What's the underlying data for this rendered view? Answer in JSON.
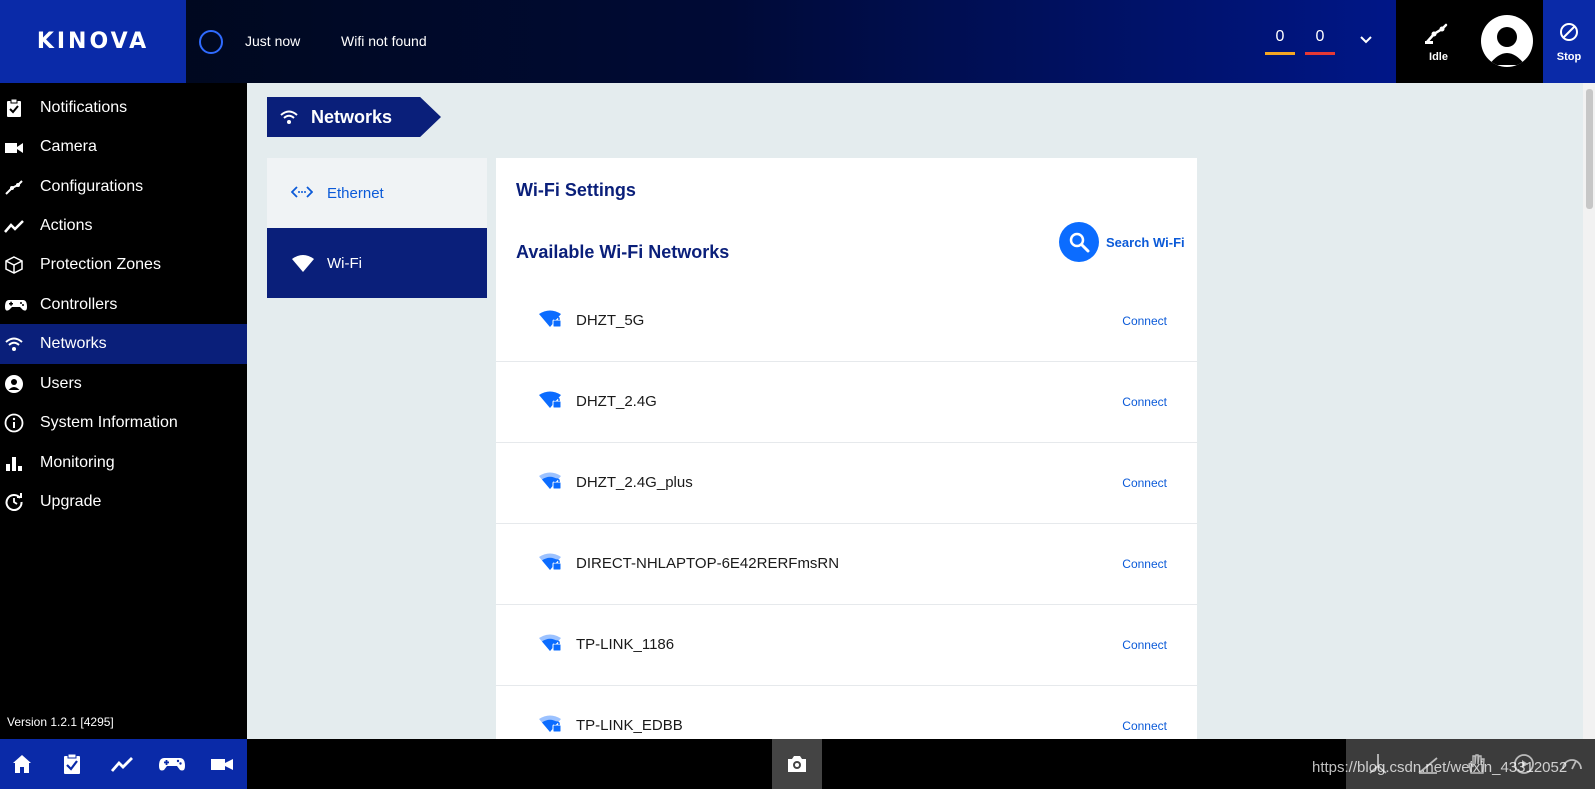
{
  "header": {
    "logo": "KINOVA",
    "status_time": "Just now",
    "wifi_status": "Wifi not found",
    "counter_warnings": "0",
    "counter_errors": "0",
    "robot_state": "Idle",
    "stop_label": "Stop"
  },
  "sidebar": {
    "items": [
      {
        "label": "Notifications",
        "icon": "notifications-icon"
      },
      {
        "label": "Camera",
        "icon": "camera-icon"
      },
      {
        "label": "Configurations",
        "icon": "configurations-icon"
      },
      {
        "label": "Actions",
        "icon": "actions-icon"
      },
      {
        "label": "Protection Zones",
        "icon": "protection-zones-icon"
      },
      {
        "label": "Controllers",
        "icon": "controllers-icon"
      },
      {
        "label": "Networks",
        "icon": "wifi-icon"
      },
      {
        "label": "Users",
        "icon": "user-icon"
      },
      {
        "label": "System Information",
        "icon": "info-icon"
      },
      {
        "label": "Monitoring",
        "icon": "monitoring-icon"
      },
      {
        "label": "Upgrade",
        "icon": "upgrade-icon"
      }
    ],
    "active": "Networks",
    "version": "Version 1.2.1 [4295]"
  },
  "page": {
    "title": "Networks",
    "tabs": [
      {
        "label": "Ethernet"
      },
      {
        "label": "Wi-Fi"
      }
    ],
    "panel_title": "Wi-Fi Settings",
    "available_title": "Available Wi-Fi Networks",
    "search_label": "Search Wi-Fi",
    "connect_label": "Connect",
    "networks": [
      {
        "ssid": "DHZT_5G",
        "signal": "strong"
      },
      {
        "ssid": "DHZT_2.4G",
        "signal": "strong"
      },
      {
        "ssid": "DHZT_2.4G_plus",
        "signal": "medium"
      },
      {
        "ssid": "DIRECT-NHLAPTOP-6E42RERFmsRN",
        "signal": "medium"
      },
      {
        "ssid": "TP-LINK_1186",
        "signal": "medium"
      },
      {
        "ssid": "TP-LINK_EDBB",
        "signal": "medium"
      }
    ]
  },
  "watermark": "https://blog.csdn.net/weixin_43312052",
  "colors": {
    "brand": "#0a2aa8",
    "nav_active": "#0a1f7a",
    "accent": "#0b6cff",
    "warning": "#f5a623",
    "error": "#e53935"
  }
}
